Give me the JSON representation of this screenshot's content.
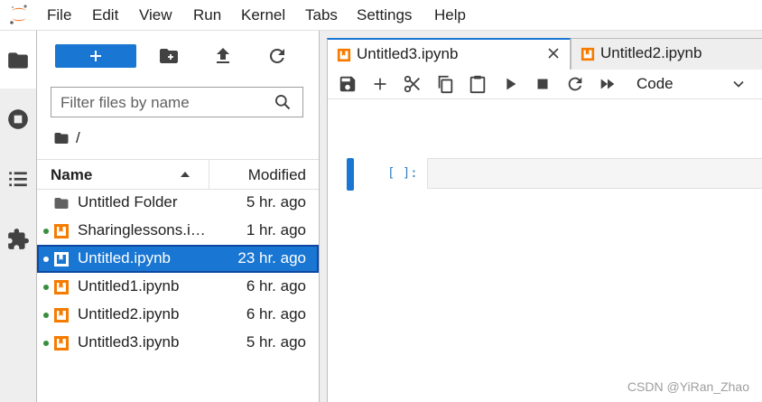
{
  "menubar": {
    "items": [
      "File",
      "Edit",
      "View",
      "Run",
      "Kernel",
      "Tabs",
      "Settings",
      "Help"
    ]
  },
  "sidebar": {
    "icons": [
      "folder-icon",
      "running-icon",
      "table-of-contents-icon",
      "extension-icon"
    ]
  },
  "filebrowser": {
    "toolbar": {
      "new_launcher": "+",
      "icons": [
        "new-folder-icon",
        "upload-icon",
        "refresh-icon"
      ]
    },
    "filter_placeholder": "Filter files by name",
    "breadcrumb": "/",
    "columns": {
      "name": "Name",
      "modified": "Modified"
    },
    "files": [
      {
        "name": "Untitled Folder",
        "modified": "5 hr. ago",
        "type": "folder",
        "running": false,
        "selected": false
      },
      {
        "name": "Sharinglessons.ipynb",
        "modified": "1 hr. ago",
        "type": "notebook",
        "running": true,
        "selected": false
      },
      {
        "name": "Untitled.ipynb",
        "modified": "23 hr. ago",
        "type": "notebook",
        "running": true,
        "selected": true
      },
      {
        "name": "Untitled1.ipynb",
        "modified": "6 hr. ago",
        "type": "notebook",
        "running": true,
        "selected": false
      },
      {
        "name": "Untitled2.ipynb",
        "modified": "6 hr. ago",
        "type": "notebook",
        "running": true,
        "selected": false
      },
      {
        "name": "Untitled3.ipynb",
        "modified": "5 hr. ago",
        "type": "notebook",
        "running": true,
        "selected": false
      }
    ]
  },
  "tabs": [
    {
      "label": "Untitled3.ipynb",
      "active": true
    },
    {
      "label": "Untitled2.ipynb",
      "active": false
    }
  ],
  "notebook": {
    "toolbar_icons": [
      "save-icon",
      "add-cell-icon",
      "cut-icon",
      "copy-icon",
      "paste-icon",
      "run-icon",
      "interrupt-icon",
      "restart-icon",
      "run-all-icon"
    ],
    "cell_type": "Code",
    "cell_prompt": "[ ]:"
  },
  "watermark": "CSDN @YiRan_Zhao",
  "colors": {
    "accent": "#1976d2",
    "notebook_orange": "#f57c00",
    "running_dot": "#388e3c"
  }
}
